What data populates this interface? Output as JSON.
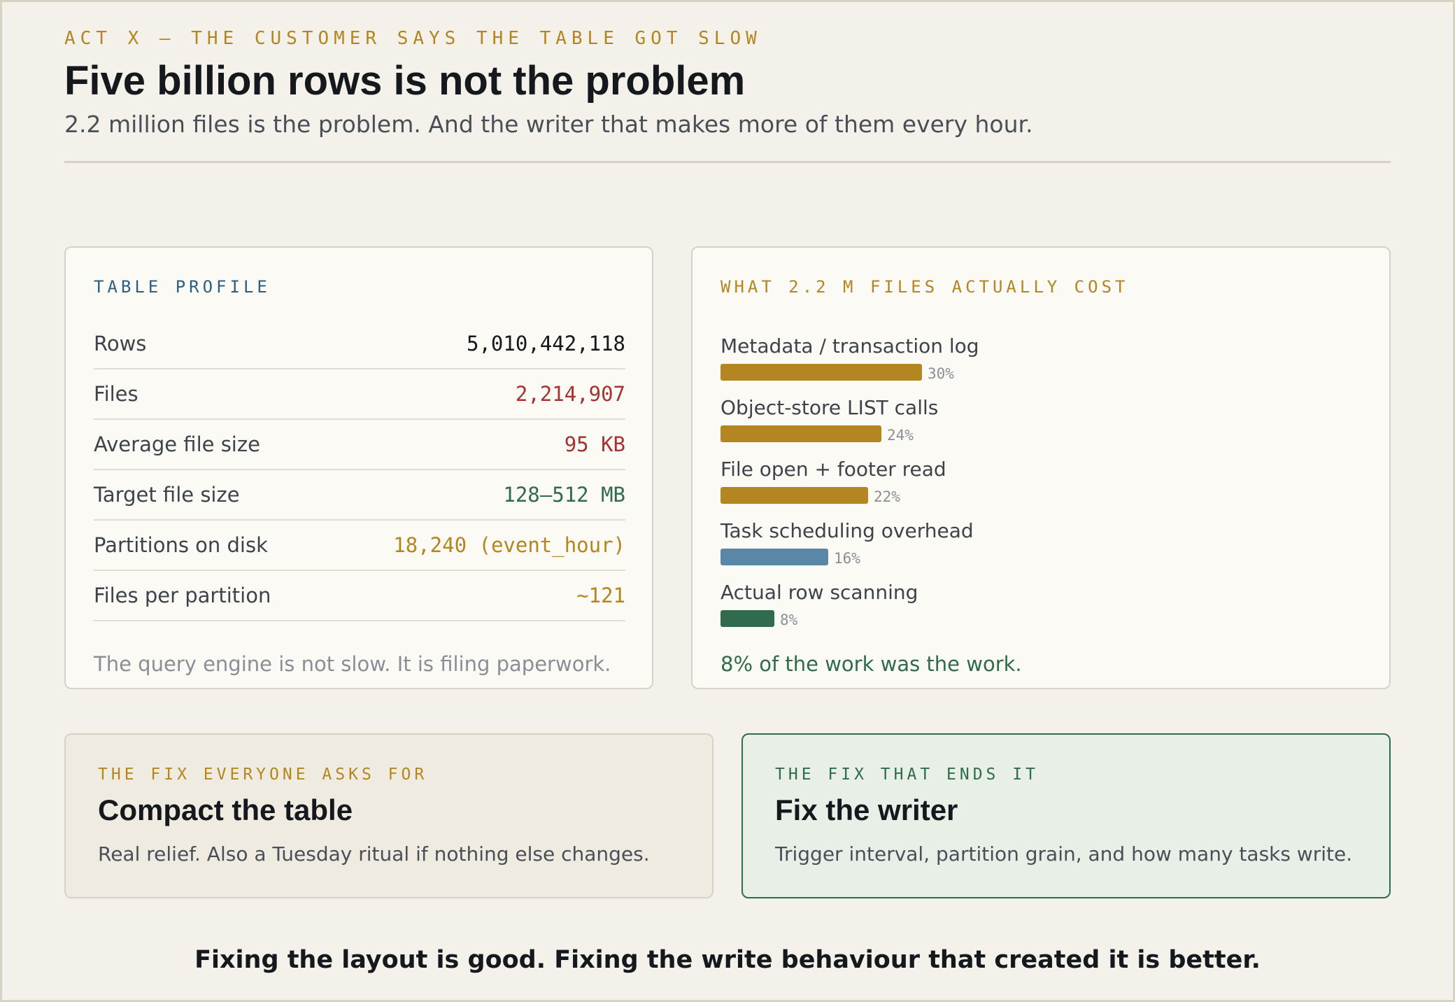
{
  "header": {
    "eyebrow": "ACT X — THE CUSTOMER SAYS THE TABLE GOT SLOW",
    "title": "Five billion rows is not the problem",
    "subtitle": "2.2 million files is the problem. And the writer that makes more of them every hour."
  },
  "profile": {
    "label": "TABLE PROFILE",
    "rows": [
      {
        "key": "Rows",
        "value": "5,010,442,118"
      },
      {
        "key": "Files",
        "value": "2,214,907"
      },
      {
        "key": "Average file size",
        "value": "95 KB"
      },
      {
        "key": "Target file size",
        "value": "128–512 MB"
      },
      {
        "key": "Partitions on disk",
        "value": "18,240 (event_hour)"
      },
      {
        "key": "Files per partition",
        "value": "~121"
      }
    ],
    "note": "The query engine is not slow. It is filing paperwork."
  },
  "cost": {
    "label": "WHAT 2.2 M FILES ACTUALLY COST",
    "items": [
      {
        "label": "Metadata / transaction log",
        "percent": 30,
        "pct_text": "30%",
        "color": "#b38621"
      },
      {
        "label": "Object-store LIST calls",
        "percent": 24,
        "pct_text": "24%",
        "color": "#b38621"
      },
      {
        "label": "File open + footer read",
        "percent": 22,
        "pct_text": "22%",
        "color": "#b38621"
      },
      {
        "label": "Task scheduling overhead",
        "percent": 16,
        "pct_text": "16%",
        "color": "#5b87a6"
      },
      {
        "label": "Actual row scanning",
        "percent": 8,
        "pct_text": "8%",
        "color": "#2f6b4c"
      }
    ],
    "note": "8% of the work was the work."
  },
  "fix_common": {
    "label": "THE FIX EVERYONE ASKS FOR",
    "title": "Compact the table",
    "desc": "Real relief. Also a Tuesday ritual if nothing else changes."
  },
  "fix_real": {
    "label": "THE FIX THAT ENDS IT",
    "title": "Fix the writer",
    "desc": "Trigger interval, partition grain, and how many tasks write."
  },
  "footer": "Fixing the layout is good. Fixing the write behaviour that created it is better."
}
